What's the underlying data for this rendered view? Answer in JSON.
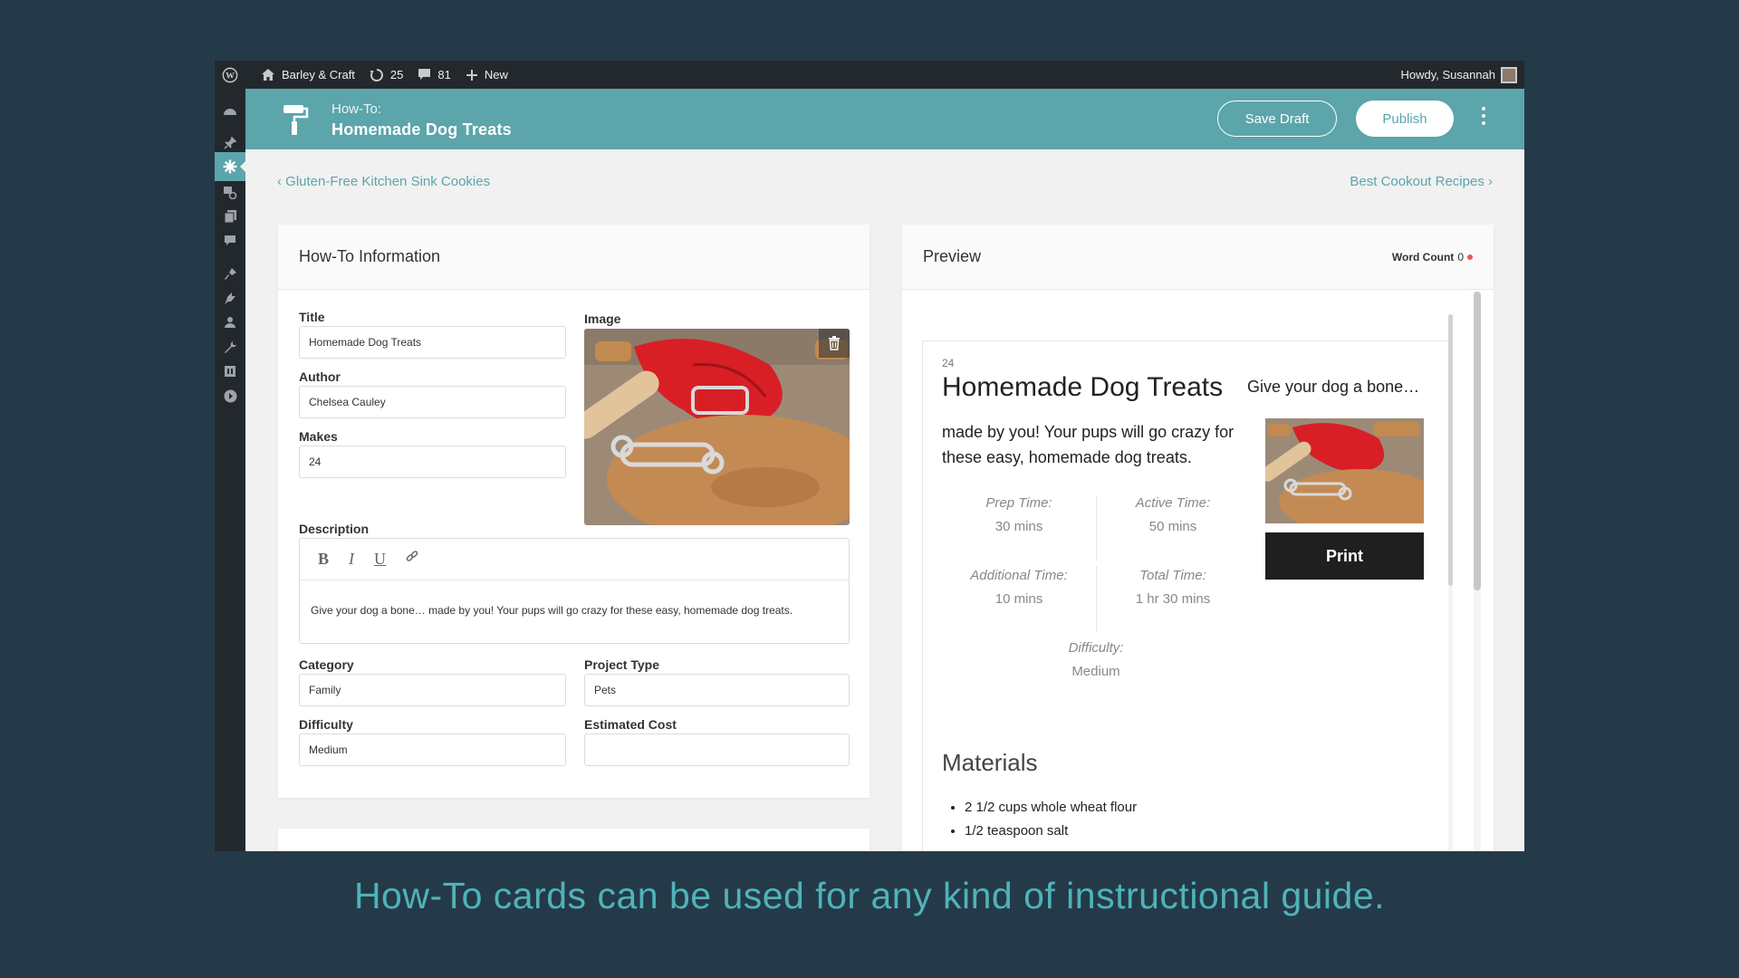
{
  "admin_bar": {
    "site_name": "Barley & Craft",
    "updates_count": "25",
    "comments_count": "81",
    "new_label": "New",
    "greeting": "Howdy, Susannah"
  },
  "header": {
    "label": "How-To:",
    "title": "Homemade Dog Treats",
    "save_draft": "Save Draft",
    "publish": "Publish"
  },
  "nav": {
    "prev": "Gluten-Free Kitchen Sink Cookies",
    "next": "Best Cookout Recipes"
  },
  "info": {
    "heading": "How-To Information",
    "title_label": "Title",
    "title_value": "Homemade Dog Treats",
    "author_label": "Author",
    "author_value": "Chelsea Cauley",
    "makes_label": "Makes",
    "makes_value": "24",
    "image_label": "Image",
    "description_label": "Description",
    "description_value": "Give your dog a bone… made by you! Your pups will go crazy for these easy, homemade dog treats.",
    "category_label": "Category",
    "category_value": "Family",
    "project_type_label": "Project Type",
    "project_type_value": "Pets",
    "difficulty_label": "Difficulty",
    "difficulty_value": "Medium",
    "estimated_cost_label": "Estimated Cost",
    "estimated_cost_value": ""
  },
  "toolbar": {
    "bold": "B",
    "italic": "I",
    "underline": "U"
  },
  "preview": {
    "heading": "Preview",
    "word_count_label": "Word Count",
    "word_count_value": "0",
    "makes": "24",
    "title": "Homemade Dog Treats",
    "desc_part1": "Give your dog a bone…",
    "desc_part2": "made by you! Your pups will go crazy for these easy, homemade dog treats.",
    "times": [
      {
        "label": "Prep Time:",
        "value": "30 mins"
      },
      {
        "label": "Active Time:",
        "value": "50 mins"
      },
      {
        "label": "Additional Time:",
        "value": "10 mins"
      },
      {
        "label": "Total Time:",
        "value": "1 hr 30 mins"
      }
    ],
    "difficulty_label": "Difficulty:",
    "difficulty_value": "Medium",
    "print": "Print",
    "materials_heading": "Materials",
    "materials": [
      "2 1/2 cups whole wheat flour",
      "1/2 teaspoon salt"
    ]
  },
  "caption": "How-To cards can be used for any kind of instructional guide.",
  "colors": {
    "accent": "#5ba5ab",
    "admin_bar": "#23282d",
    "background": "#253a49",
    "caption": "#4fb3b8"
  },
  "icons": [
    "wordpress-icon",
    "home-icon",
    "updates-icon",
    "comment-icon",
    "plus-icon",
    "paint-roller-icon",
    "trash-icon",
    "link-icon"
  ]
}
